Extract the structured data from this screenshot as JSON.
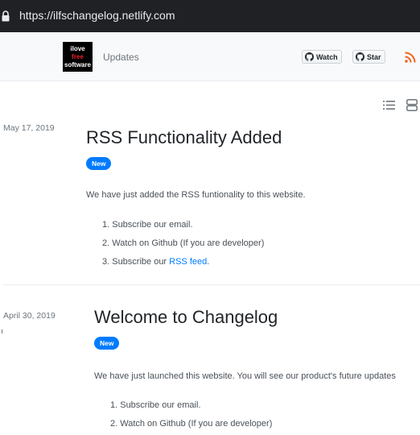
{
  "browser": {
    "url": "https://ilfschangelog.netlify.com"
  },
  "navbar": {
    "logo": {
      "line1": "ilove",
      "line2": "free",
      "line3": "software"
    },
    "title": "Updates",
    "watch_label": "Watch",
    "star_label": "Star",
    "colors": {
      "badge": "#007bff",
      "link": "#007bff",
      "rss": "#f26522"
    }
  },
  "entries": [
    {
      "date": "May 17, 2019",
      "title": "RSS Functionality Added",
      "badge": "New",
      "text": "We have just added the RSS funtionality to this website.",
      "list": [
        {
          "text": "1. Subscribe our email."
        },
        {
          "text": "2. Watch on Github (If you are developer)"
        },
        {
          "text": "3. Subscribe our ",
          "link": "RSS feed",
          "after": "."
        }
      ]
    },
    {
      "date": "April 30, 2019",
      "title": "Welcome to Changelog",
      "badge": "New",
      "text": "We have just launched this website. You will see our product's future updates",
      "list": [
        {
          "text": "1. Subscribe our email."
        },
        {
          "text": "2. Watch on Github (If you are developer)"
        }
      ]
    }
  ]
}
